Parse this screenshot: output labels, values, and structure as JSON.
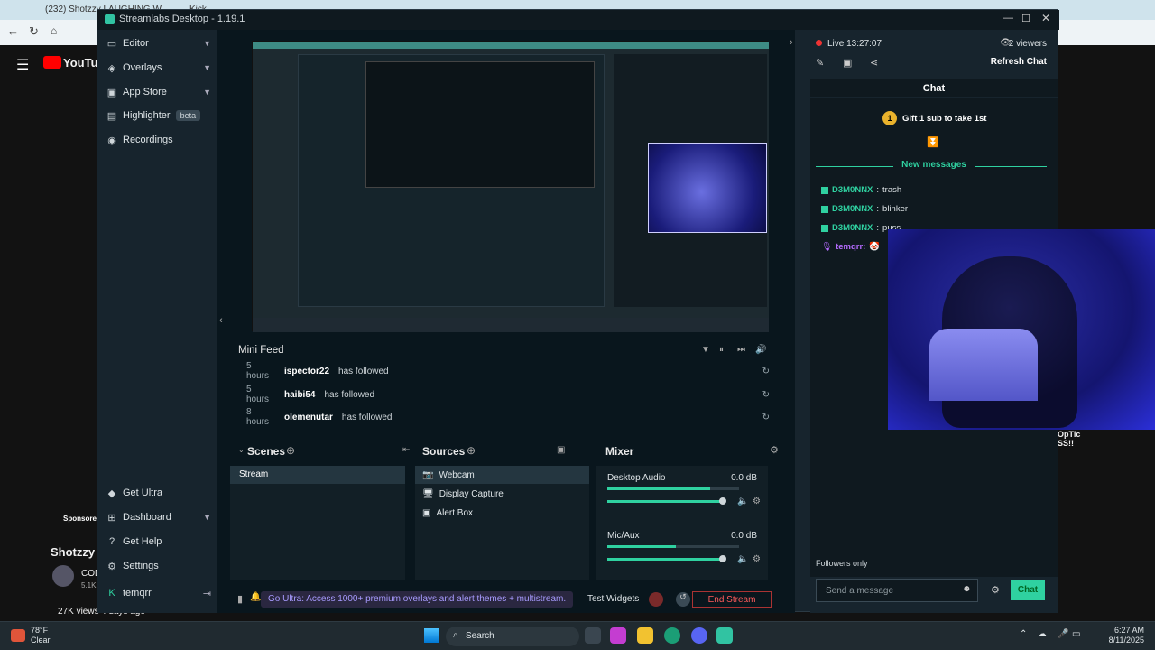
{
  "browser": {
    "tab1": "(232) Shotzzy LAUGHING W",
    "tab2": "Kick",
    "youtube": {
      "logo": "YouTube",
      "sponsored": "Sponsored",
      "channel": "Shotzzy",
      "sub_initials": "COD",
      "sub_count": "5.1K",
      "views": "27K views",
      "ago": "4 days ago",
      "side_snippet": "OpTic\nSS!!"
    }
  },
  "streamlabs": {
    "title": "Streamlabs Desktop - 1.19.1",
    "sidebar": {
      "items": [
        {
          "label": "Editor",
          "icon": "editor-icon"
        },
        {
          "label": "Overlays",
          "icon": "overlays-icon"
        },
        {
          "label": "App Store",
          "icon": "store-icon"
        },
        {
          "label": "Highlighter",
          "icon": "highlighter-icon",
          "badge": "beta"
        },
        {
          "label": "Recordings",
          "icon": "recordings-icon"
        }
      ],
      "bottom_items": [
        {
          "label": "Get Ultra",
          "icon": "ultra-icon"
        },
        {
          "label": "Dashboard",
          "icon": "dashboard-icon"
        },
        {
          "label": "Get Help",
          "icon": "help-icon"
        },
        {
          "label": "Settings",
          "icon": "settings-icon"
        },
        {
          "label": "temqrr",
          "icon": "user-icon"
        }
      ]
    },
    "minifeed": {
      "title": "Mini Feed",
      "rows": [
        {
          "time": "5 hours",
          "user": "ispector22",
          "action": "has followed"
        },
        {
          "time": "5 hours",
          "user": "haibi54",
          "action": "has followed"
        },
        {
          "time": "8 hours",
          "user": "olemenutar",
          "action": "has followed"
        }
      ]
    },
    "scenes": {
      "title": "Scenes",
      "items": [
        "Stream"
      ]
    },
    "sources": {
      "title": "Sources",
      "items": [
        "Webcam",
        "Display Capture",
        "Alert Box"
      ]
    },
    "mixer": {
      "title": "Mixer",
      "channels": [
        {
          "name": "Desktop Audio",
          "db": "0.0 dB",
          "level": 0.78
        },
        {
          "name": "Mic/Aux",
          "db": "0.0 dB",
          "level": 0.52
        }
      ]
    },
    "footer": {
      "ultra": "Go Ultra: Access 1000+ premium overlays and alert themes + multistream.",
      "test_widgets": "Test Widgets",
      "end_stream": "End Stream"
    },
    "chat": {
      "live": "Live 13:27:07",
      "viewers": "2 viewers",
      "refresh": "Refresh Chat",
      "header": "Chat",
      "gift": "Gift 1 sub to take 1st",
      "gift_num": "1",
      "new_messages": "New messages",
      "messages": [
        {
          "user": "D3M0NNX",
          "text": "trash"
        },
        {
          "user": "D3M0NNX",
          "text": "blinker"
        },
        {
          "user": "D3M0NNX",
          "text": "puss"
        }
      ],
      "last_user": "temqrr:",
      "followers_only": "Followers only",
      "placeholder": "Send a message",
      "send": "Chat"
    }
  },
  "taskbar": {
    "temp": "78°F",
    "weather": "Clear",
    "search": "Search",
    "time": "6:27 AM",
    "date": "8/11/2025"
  }
}
